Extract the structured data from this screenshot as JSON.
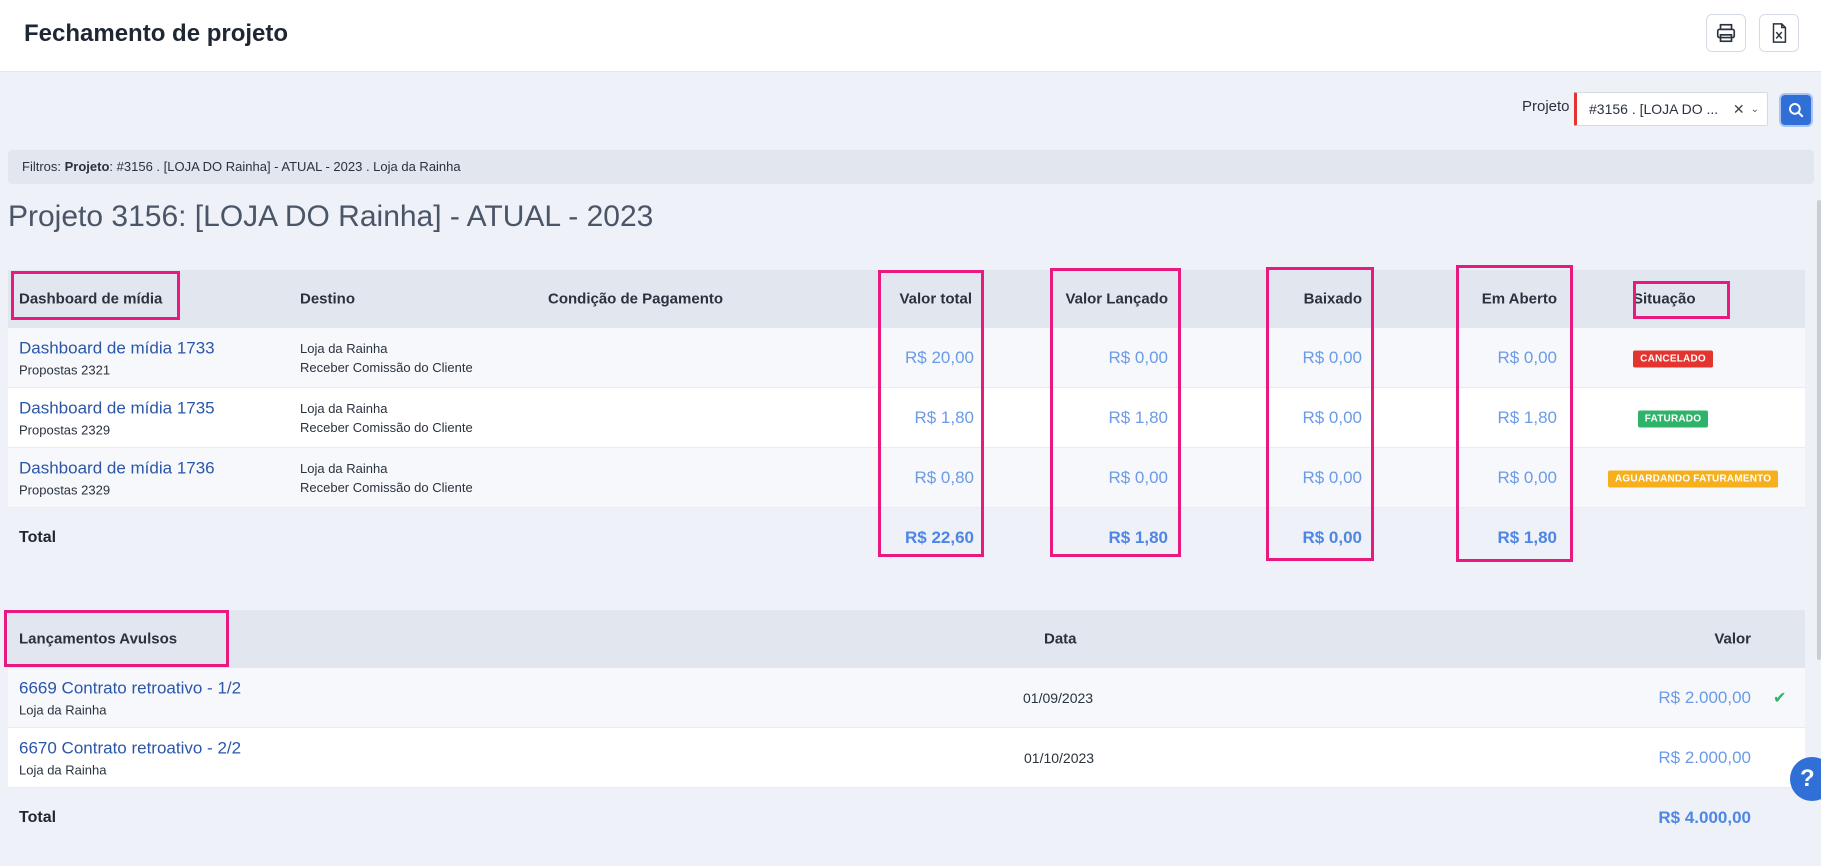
{
  "header": {
    "title": "Fechamento de projeto"
  },
  "filter": {
    "project_label": "Projeto",
    "project_value": "#3156 . [LOJA DO ...",
    "clear_glyph": "✕",
    "chevron_glyph": "⌄"
  },
  "filters_bar": {
    "prefix": "Filtros: ",
    "key": "Projeto",
    "value": ": #3156 . [LOJA DO Rainha] - ATUAL - 2023 . Loja da Rainha"
  },
  "project_heading": "Projeto 3156: [LOJA DO Rainha] - ATUAL - 2023",
  "media_table": {
    "headers": {
      "name": "Dashboard de mídia",
      "destino": "Destino",
      "condicao": "Condição de Pagamento",
      "valor_total": "Valor total",
      "valor_lancado": "Valor Lançado",
      "baixado": "Baixado",
      "em_aberto": "Em Aberto",
      "situacao": "Situação"
    },
    "rows": [
      {
        "title": "Dashboard de mídia 1733",
        "subtitle": "Propostas 2321",
        "destino1": "Loja da Rainha",
        "destino2": "Receber Comissão do Cliente",
        "valor_total": "R$ 20,00",
        "valor_lancado": "R$ 0,00",
        "baixado": "R$ 0,00",
        "em_aberto": "R$ 0,00",
        "situacao": "CANCELADO",
        "situacao_color": "#e3342f"
      },
      {
        "title": "Dashboard de mídia 1735",
        "subtitle": "Propostas 2329",
        "destino1": "Loja da Rainha",
        "destino2": "Receber Comissão do Cliente",
        "valor_total": "R$ 1,80",
        "valor_lancado": "R$ 1,80",
        "baixado": "R$ 0,00",
        "em_aberto": "R$ 1,80",
        "situacao": "FATURADO",
        "situacao_color": "#2fb36a"
      },
      {
        "title": "Dashboard de mídia 1736",
        "subtitle": "Propostas 2329",
        "destino1": "Loja da Rainha",
        "destino2": "Receber Comissão do Cliente",
        "valor_total": "R$ 0,80",
        "valor_lancado": "R$ 0,00",
        "baixado": "R$ 0,00",
        "em_aberto": "R$ 0,00",
        "situacao": "AGUARDANDO FATURAMENTO",
        "situacao_color": "#f6b01e"
      }
    ],
    "total": {
      "label": "Total",
      "valor_total": "R$ 22,60",
      "valor_lancado": "R$ 1,80",
      "baixado": "R$ 0,00",
      "em_aberto": "R$ 1,80"
    }
  },
  "avulsos_table": {
    "headers": {
      "name": "Lançamentos Avulsos",
      "data": "Data",
      "valor": "Valor"
    },
    "rows": [
      {
        "title": "6669 Contrato retroativo - 1/2",
        "subtitle": "Loja da Rainha",
        "data": "01/09/2023",
        "valor": "R$ 2.000,00",
        "check": "✔"
      },
      {
        "title": "6670 Contrato retroativo - 2/2",
        "subtitle": "Loja da Rainha",
        "data": "01/10/2023",
        "valor": "R$ 2.000,00",
        "check": ""
      }
    ],
    "total": {
      "label": "Total",
      "valor": "R$ 4.000,00"
    }
  },
  "help": {
    "glyph": "?"
  },
  "colors": {
    "accent": "#2f6fd6",
    "highlight": "#e8197f",
    "money": "#6b9be8"
  }
}
